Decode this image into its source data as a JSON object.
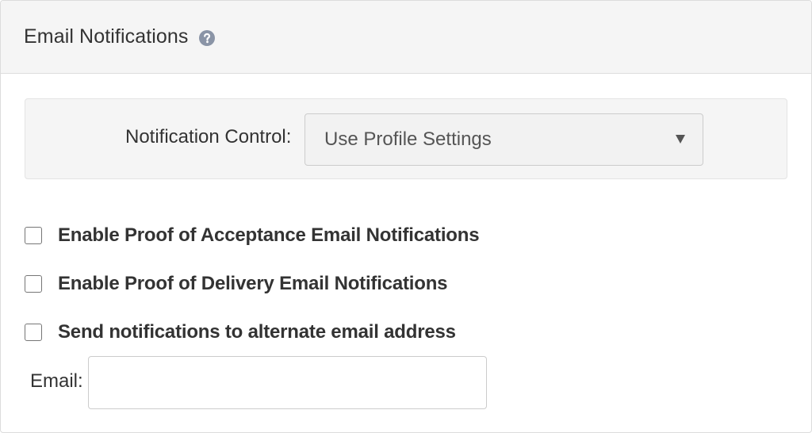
{
  "header": {
    "title": "Email Notifications",
    "help_icon": "question-circle-icon"
  },
  "notification_control": {
    "label": "Notification Control:",
    "selected": "Use Profile Settings"
  },
  "checkboxes": [
    {
      "label": "Enable Proof of Acceptance Email Notifications",
      "checked": false
    },
    {
      "label": "Enable Proof of Delivery Email Notifications",
      "checked": false
    },
    {
      "label": "Send notifications to alternate email address",
      "checked": false
    }
  ],
  "email": {
    "label": "Email:",
    "value": "",
    "placeholder": ""
  },
  "colors": {
    "header_bg": "#f5f5f5",
    "help_icon": "#8a94a6",
    "text": "#333333"
  }
}
